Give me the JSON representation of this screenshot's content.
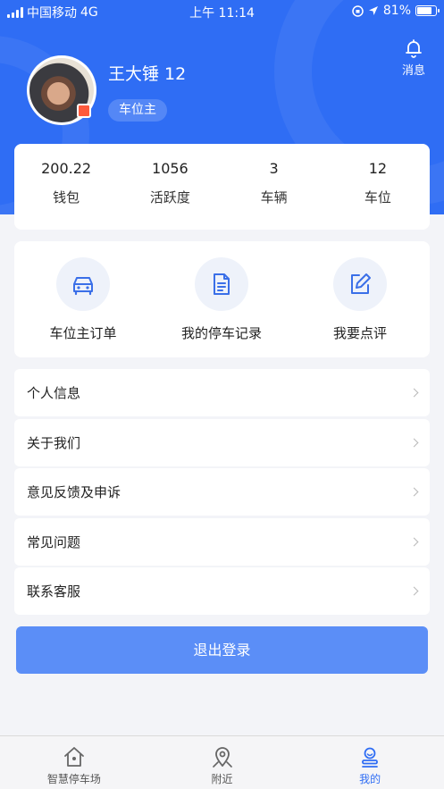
{
  "status_bar": {
    "carrier": "中国移动",
    "network": "4G",
    "time": "上午 11:14",
    "battery": "81%",
    "battery_level": 0.81
  },
  "header": {
    "message_label": "消息",
    "user_name": "王大锤 12",
    "role": "车位主"
  },
  "stats": [
    {
      "value": "200.22",
      "label": "钱包"
    },
    {
      "value": "1056",
      "label": "活跃度"
    },
    {
      "value": "3",
      "label": "车辆"
    },
    {
      "value": "12",
      "label": "车位"
    }
  ],
  "actions": [
    {
      "label": "车位主订单",
      "icon": "car-icon"
    },
    {
      "label": "我的停车记录",
      "icon": "document-icon"
    },
    {
      "label": "我要点评",
      "icon": "edit-icon"
    }
  ],
  "menu": [
    {
      "label": "个人信息"
    },
    {
      "label": "关于我们"
    },
    {
      "label": "意见反馈及申诉"
    },
    {
      "label": "常见问题"
    },
    {
      "label": "联系客服"
    }
  ],
  "logout_label": "退出登录",
  "tabs": [
    {
      "label": "智慧停车场",
      "icon": "home-icon",
      "active": false
    },
    {
      "label": "附近",
      "icon": "location-pin-icon",
      "active": false
    },
    {
      "label": "我的",
      "icon": "profile-icon",
      "active": true
    }
  ],
  "colors": {
    "primary": "#2f6df4",
    "button": "#5b8ef7",
    "background": "#f3f4f8"
  }
}
